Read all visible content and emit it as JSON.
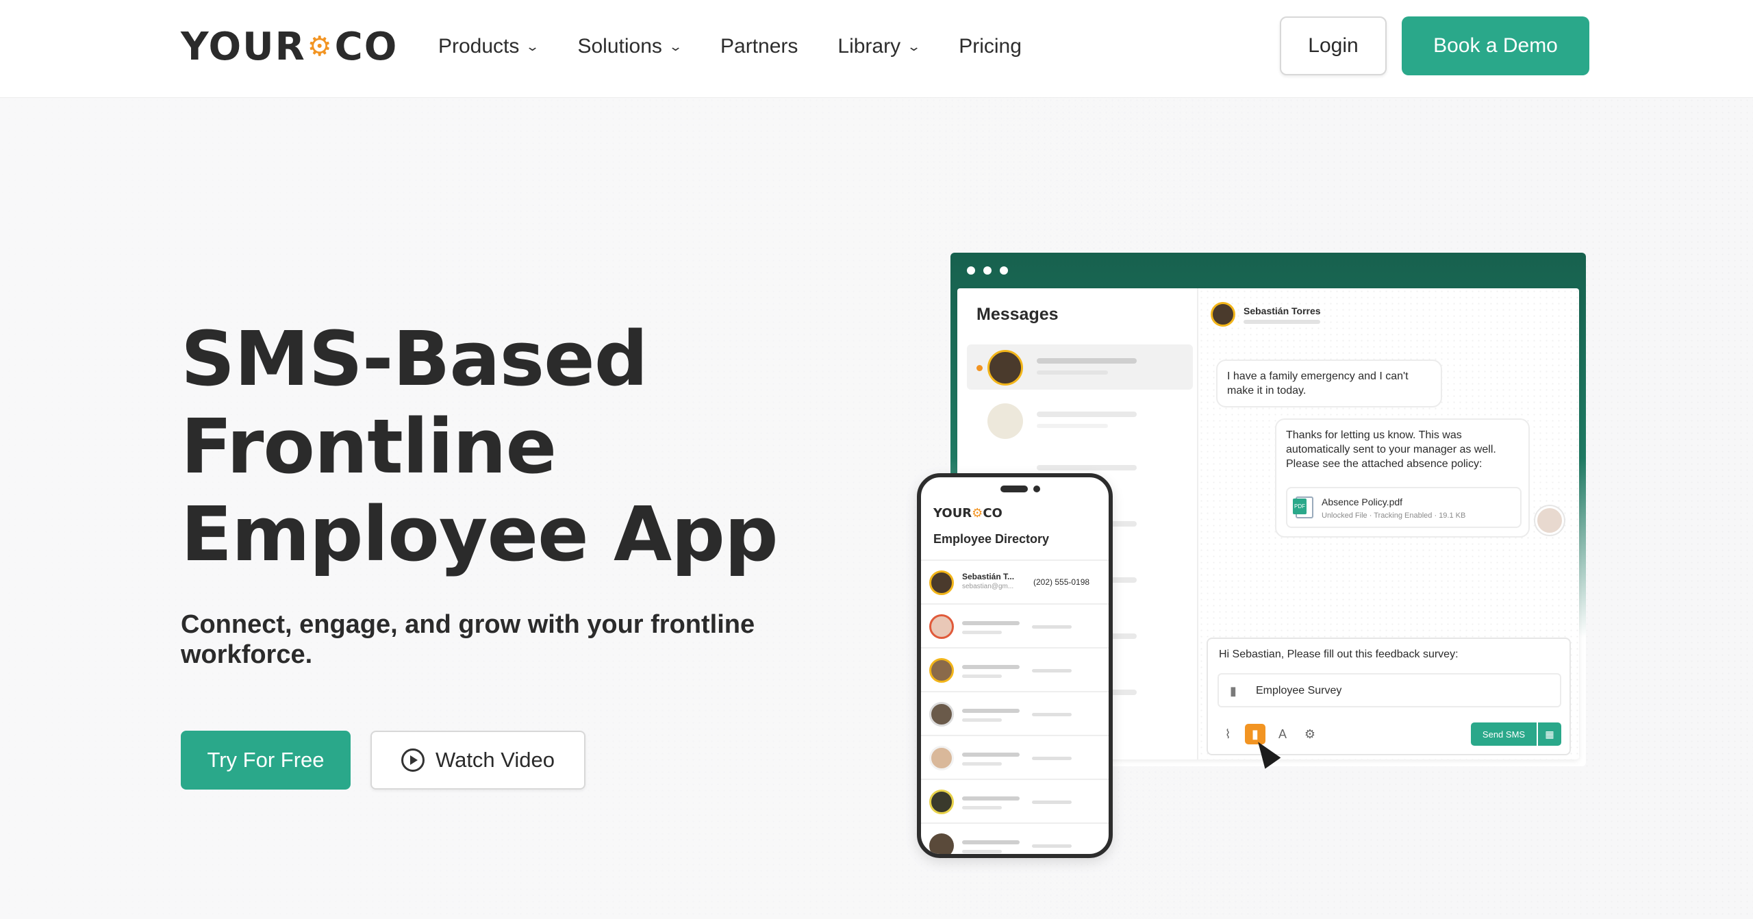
{
  "brand": {
    "logo_left": "YOUR",
    "logo_right": "CO",
    "logo_icon": "gear-icon"
  },
  "nav": {
    "items": [
      {
        "label": "Products",
        "dropdown": true
      },
      {
        "label": "Solutions",
        "dropdown": true
      },
      {
        "label": "Partners",
        "dropdown": false
      },
      {
        "label": "Library",
        "dropdown": true
      },
      {
        "label": "Pricing",
        "dropdown": false
      }
    ],
    "login": "Login",
    "demo": "Book a Demo"
  },
  "hero": {
    "title_line1": "SMS-Based",
    "title_line2": "Frontline",
    "title_line3": "Employee App",
    "subtitle": "Connect, engage, and grow with your frontline workforce.",
    "cta_primary": "Try For Free",
    "cta_secondary": "Watch Video"
  },
  "desktop": {
    "messages_title": "Messages",
    "contact_name": "Sebastián Torres",
    "incoming": "I have a family emergency and I can't make it in today.",
    "reply": "Thanks for letting us know. This was automatically sent to your manager as well. Please see the attached absence policy:",
    "attachment_name": "Absence Policy.pdf",
    "attachment_meta": "Unlocked File · Tracking Enabled · 19.1 KB",
    "attachment_badge": "PDF",
    "composer_text": "Hi Sebastian, Please fill out this feedback survey:",
    "survey_label": "Employee Survey",
    "send_label": "Send SMS"
  },
  "phone": {
    "logo_left": "YOUR",
    "logo_right": "CO",
    "title": "Employee Directory",
    "first_name": "Sebastián T...",
    "first_email": "sebastian@gm...",
    "first_phone": "(202) 555-0198"
  },
  "colors": {
    "accent": "#2aa88a",
    "brand_orange": "#f29422",
    "header_dark": "#17614e"
  }
}
